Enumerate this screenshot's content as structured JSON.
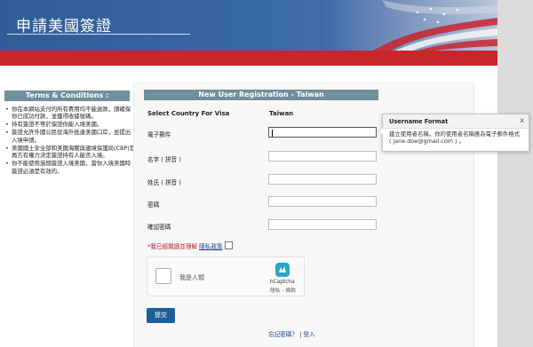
{
  "header": {
    "site_title": "申請美國簽證"
  },
  "terms": {
    "title": "Terms & Conditions :",
    "items": [
      "你在本網站支付的所有費用均不能退款，請確保你已成功付款，並獲得收據號碼。",
      "持有簽證不等於保證你能入境美國。",
      "簽證允許外國公民從海外抵達美國口岸，並提出入境申請。",
      "美國國土安全部和美國海關與邊境保護局(CBP)官員方有權力決定簽證持有人能否入境。",
      "你不能使用過期簽證入境美國，當你入境美國時簽證必須是有效的。"
    ]
  },
  "form": {
    "header": "New User Registration - Taiwan",
    "country_label": "Select Country For Visa",
    "country_value": "Taiwan",
    "fields": {
      "email_label": "電子郵件",
      "first_name_label": "名字 ( 拼音 )",
      "last_name_label": "姓氏 ( 拼音 )",
      "password_label": "密碼",
      "confirm_password_label": "確認密碼"
    },
    "privacy": {
      "agree_text": "*我已經閱讀並理解",
      "link_text": "隱私政策"
    },
    "captcha": {
      "label": "我是人類",
      "brand": "hCaptcha",
      "links": "隱私 - 條款"
    },
    "submit_label": "提交",
    "footer": {
      "forgot_password": "忘記密碼？",
      "separator": "|",
      "login": "登入"
    }
  },
  "tooltip": {
    "title": "Username Format",
    "close": "x",
    "body": "建立使用者名稱，你的使用者名稱應為電子郵件格式 ( jane.doe@gmail.com ) 。"
  }
}
